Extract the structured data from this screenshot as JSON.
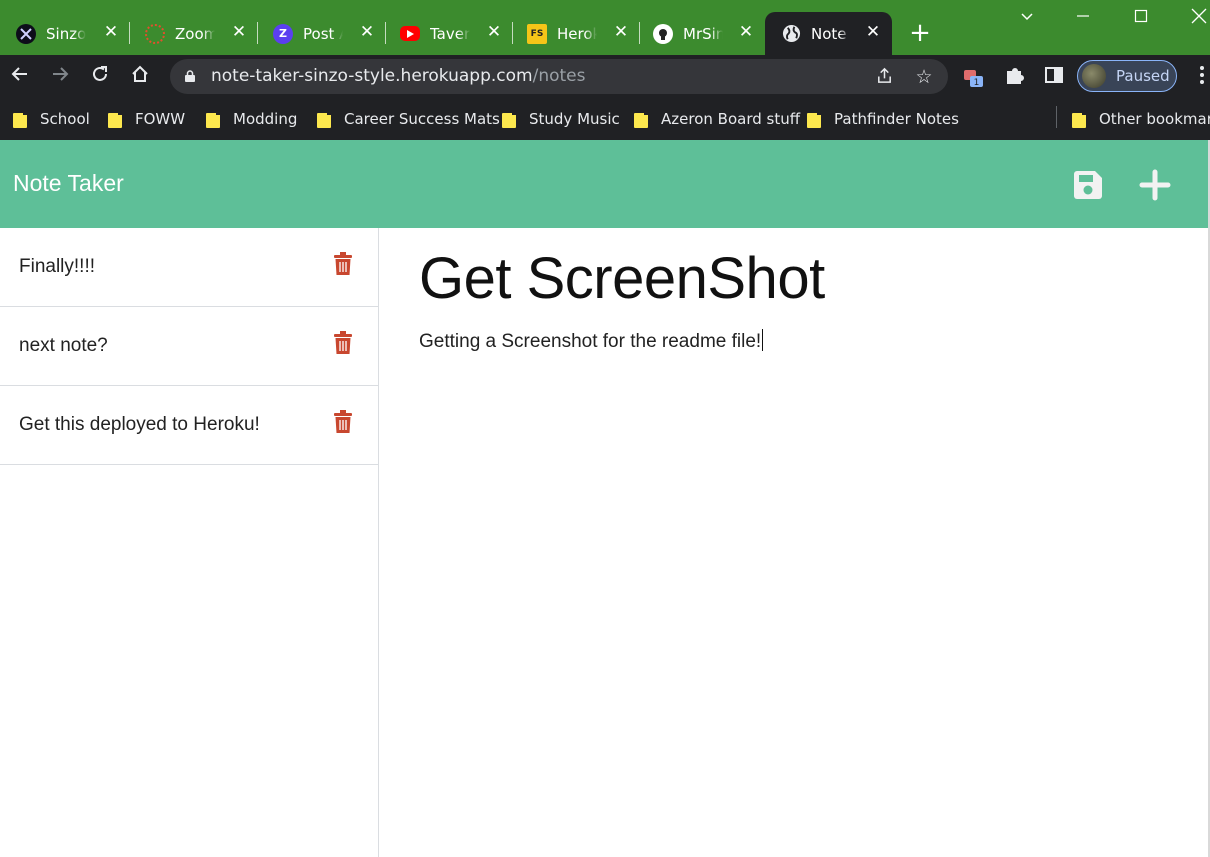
{
  "browser": {
    "tabs": [
      {
        "title": "Sinzo |",
        "icon": "x-logo-icon",
        "color": "#101020"
      },
      {
        "title": "Zoom",
        "icon": "zoom-gear-icon",
        "color": "#e0502d"
      },
      {
        "title": "Post At",
        "icon": "z-logo-icon",
        "color": "#5b3ff0"
      },
      {
        "title": "Tavern,",
        "icon": "youtube-icon",
        "color": "#ff0000"
      },
      {
        "title": "Heroku",
        "icon": "fs-logo-icon",
        "color": "#f5c518"
      },
      {
        "title": "MrSinz",
        "icon": "github-icon",
        "color": "#ffffff"
      },
      {
        "title": "Note Ta",
        "icon": "globe-icon",
        "color": "#ffffff",
        "active": true
      }
    ],
    "url_host": "note-taker-sinzo-style.herokuapp.com",
    "url_path": "/notes",
    "profile_label": "Paused",
    "extension_badge": "1",
    "bookmarks": [
      "School",
      "FOWW",
      "Modding",
      "Career Success Mats",
      "Study Music",
      "Azeron Board stuff",
      "Pathfinder Notes"
    ],
    "other_bookmarks": "Other bookmarks"
  },
  "app": {
    "brand": "Note Taker",
    "accent_color": "#5ebf98",
    "delete_color": "#c8472f",
    "notes": [
      {
        "title": "Finally!!!!"
      },
      {
        "title": "next note?"
      },
      {
        "title": "Get this deployed to Heroku!"
      }
    ],
    "active_note": {
      "title": "Get ScreenShot",
      "text": "Getting a Screenshot for the readme file!"
    }
  }
}
